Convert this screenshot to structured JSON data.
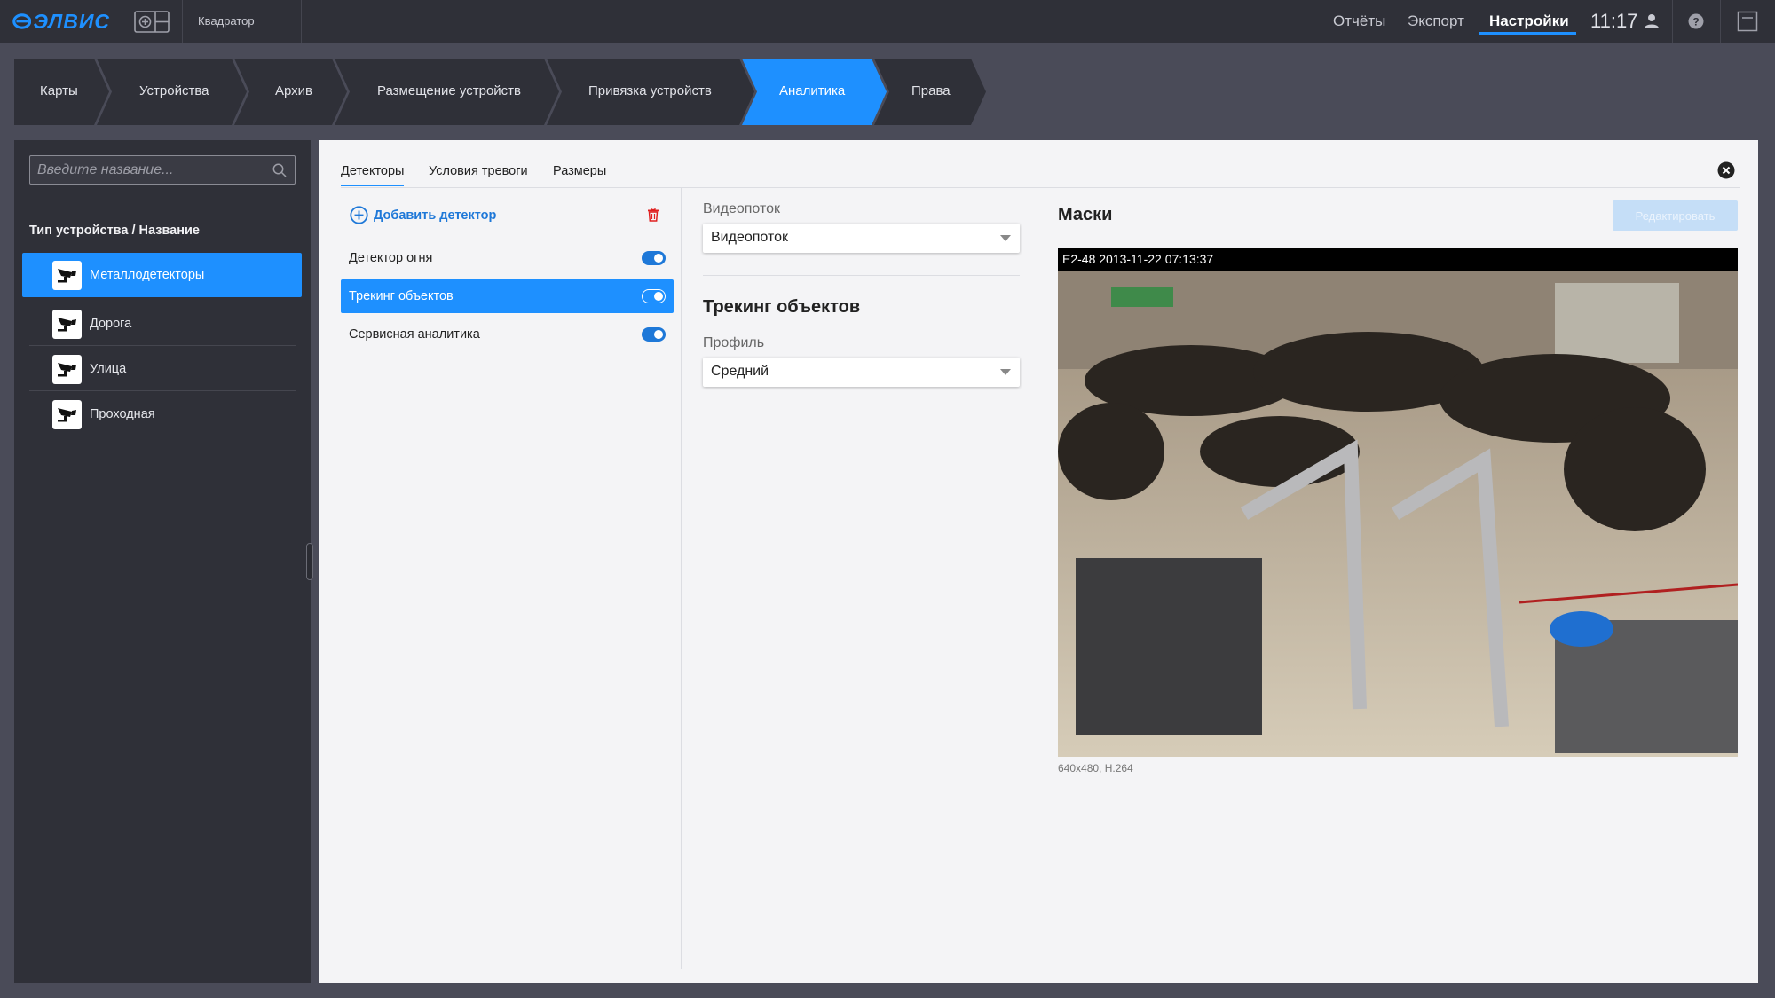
{
  "app": {
    "brand": "ЭЛВИС",
    "quad_label": "Квадратор",
    "nav": {
      "reports": "Отчёты",
      "export": "Экспорт",
      "settings": "Настройки"
    },
    "time": "11:17",
    "accent_color": "#1e90ff"
  },
  "breadcrumbs": [
    {
      "label": "Карты",
      "active": false
    },
    {
      "label": "Устройства",
      "active": false
    },
    {
      "label": "Архив",
      "active": false
    },
    {
      "label": "Размещение устройств",
      "active": false
    },
    {
      "label": "Привязка устройств",
      "active": false
    },
    {
      "label": "Аналитика",
      "active": true
    },
    {
      "label": "Права",
      "active": false
    }
  ],
  "sidebar": {
    "search_placeholder": "Введите название...",
    "list_header": "Тип устройства / Название",
    "items": [
      {
        "label": "Металлодетекторы",
        "active": true,
        "icon": "camera-icon"
      },
      {
        "label": "Дорога",
        "active": false,
        "icon": "camera-icon"
      },
      {
        "label": "Улица",
        "active": false,
        "icon": "camera-icon"
      },
      {
        "label": "Проходная",
        "active": false,
        "icon": "camera-icon"
      }
    ]
  },
  "main": {
    "tabs": [
      {
        "label": "Детекторы",
        "active": true
      },
      {
        "label": "Условия тревоги",
        "active": false
      },
      {
        "label": "Размеры",
        "active": false
      }
    ],
    "add_detector_label": "Добавить детектор",
    "detectors": [
      {
        "label": "Детектор огня",
        "enabled": true,
        "selected": false
      },
      {
        "label": "Трекинг объектов",
        "enabled": true,
        "selected": true
      },
      {
        "label": "Сервисная аналитика",
        "enabled": true,
        "selected": false
      }
    ],
    "videostream_label": "Видеопоток",
    "videostream_value": "Видеопоток",
    "section_title": "Трекинг объектов",
    "profile_label": "Профиль",
    "profile_value": "Средний",
    "masks_title": "Маски",
    "edit_button": "Редактировать",
    "video_osd": "E2-48 2013-11-22 07:13:37",
    "video_caption": "640x480, H.264"
  }
}
